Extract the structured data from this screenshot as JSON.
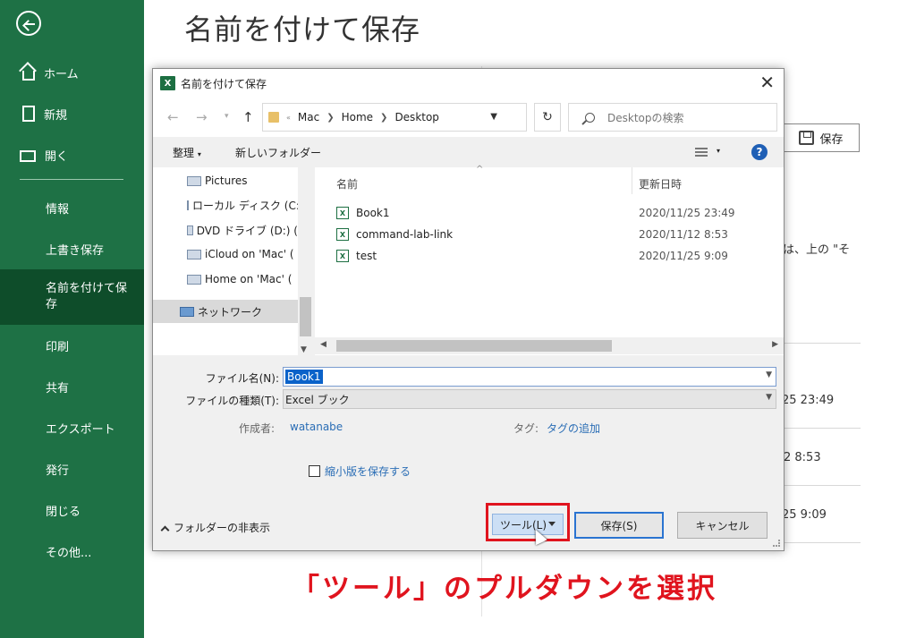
{
  "backstage": {
    "title": "名前を付けて保存",
    "nav_top": [
      {
        "label": "ホーム",
        "icon": "home-icon"
      },
      {
        "label": "新規",
        "icon": "new-document-icon"
      },
      {
        "label": "開く",
        "icon": "open-folder-icon"
      }
    ],
    "nav_bottom": [
      {
        "label": "情報"
      },
      {
        "label": "上書き保存"
      },
      {
        "label": "名前を付けて保存"
      },
      {
        "label": "印刷"
      },
      {
        "label": "共有"
      },
      {
        "label": "エクスポート"
      },
      {
        "label": "発行"
      },
      {
        "label": "閉じる"
      },
      {
        "label": "その他..."
      }
    ],
    "save_label": "保存",
    "fragment_text": "には、上の \"そ",
    "fragment_dates": [
      "25 23:49",
      "2 8:53",
      "25 9:09"
    ],
    "sidebar_color": "#1e7145"
  },
  "dialog": {
    "title": "名前を付けて保存",
    "breadcrumb": [
      "Mac",
      "Home",
      "Desktop"
    ],
    "search_placeholder": "Desktopの検索",
    "toolbar": {
      "organize": "整理",
      "new_folder": "新しいフォルダー"
    },
    "nav_tree": [
      {
        "label": "Pictures"
      },
      {
        "label": "ローカル ディスク (C:"
      },
      {
        "label": "DVD ドライブ (D:) ("
      },
      {
        "label": "iCloud on 'Mac' ("
      },
      {
        "label": "Home on 'Mac' ("
      },
      {
        "label": "ネットワーク"
      }
    ],
    "columns": {
      "name": "名前",
      "modified": "更新日時"
    },
    "files": [
      {
        "name": "Book1",
        "date": "2020/11/25 23:49"
      },
      {
        "name": "command-lab-link",
        "date": "2020/11/12 8:53"
      },
      {
        "name": "test",
        "date": "2020/11/25 9:09"
      }
    ],
    "filename_label": "ファイル名(N):",
    "filename_value": "Book1",
    "filetype_label": "ファイルの種類(T):",
    "filetype_value": "Excel ブック",
    "author_label": "作成者:",
    "author_value": "watanabe",
    "tags_label": "タグ:",
    "tags_value": "タグの追加",
    "thumbnail_label": "縮小版を保存する",
    "hide_folders_label": "フォルダーの非表示",
    "tools_label": "ツール(L)",
    "save_label": "保存(S)",
    "cancel_label": "キャンセル"
  },
  "annotation": "「ツール」のプルダウンを選択",
  "colors": {
    "highlight": "#e0141e",
    "selection": "#0a62c9",
    "link": "#2a6db5"
  }
}
